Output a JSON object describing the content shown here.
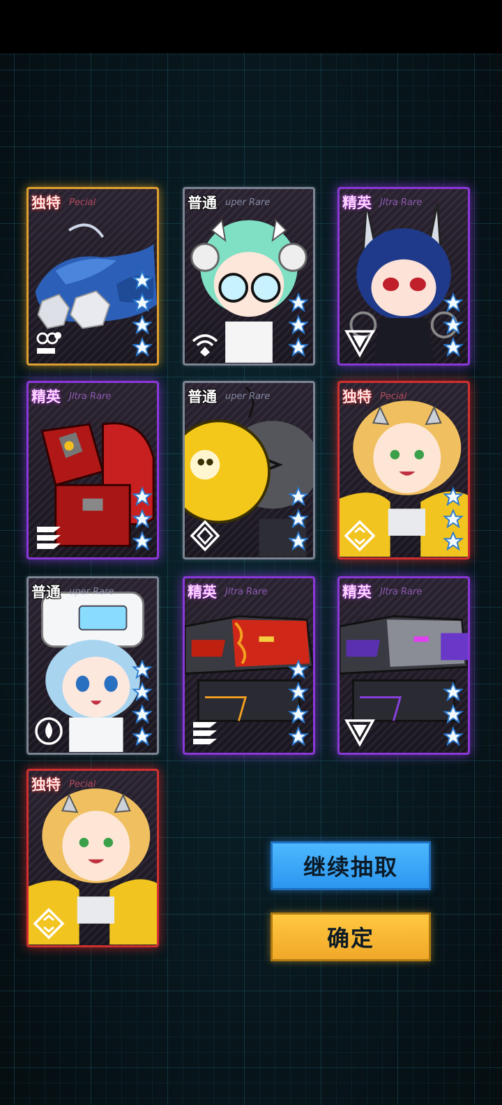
{
  "cards": [
    {
      "tier": "独特",
      "rarity": "Pecial",
      "stars": 4,
      "role": "engineer"
    },
    {
      "tier": "普通",
      "rarity": "uper Rare",
      "stars": 3,
      "role": "signal"
    },
    {
      "tier": "精英",
      "rarity": "Jltra Rare",
      "stars": 3,
      "role": "triangle"
    },
    {
      "tier": "精英",
      "rarity": "Jltra Rare",
      "stars": 3,
      "role": "stripes"
    },
    {
      "tier": "普通",
      "rarity": "uper Rare",
      "stars": 3,
      "role": "diamond"
    },
    {
      "tier": "独特",
      "rarity": "Pecial",
      "stars": 3,
      "role": "compass"
    },
    {
      "tier": "普通",
      "rarity": "uper Rare",
      "stars": 4,
      "role": "drop"
    },
    {
      "tier": "精英",
      "rarity": "Jltra Rare",
      "stars": 4,
      "role": "stripes"
    },
    {
      "tier": "精英",
      "rarity": "Jltra Rare",
      "stars": 3,
      "role": "triangle"
    },
    {
      "tier": "独特",
      "rarity": "Pecial",
      "stars": 0,
      "role": "compass"
    }
  ],
  "buttons": {
    "continue_label": "继续抽取",
    "confirm_label": "确定"
  },
  "colors": {
    "unique_border": "#e0a030",
    "unique_red_border": "#d03030",
    "elite_border": "#8a38d8",
    "normal_border": "#7c8594",
    "blue_button": "#2c96f0",
    "yellow_button": "#f0a828"
  }
}
